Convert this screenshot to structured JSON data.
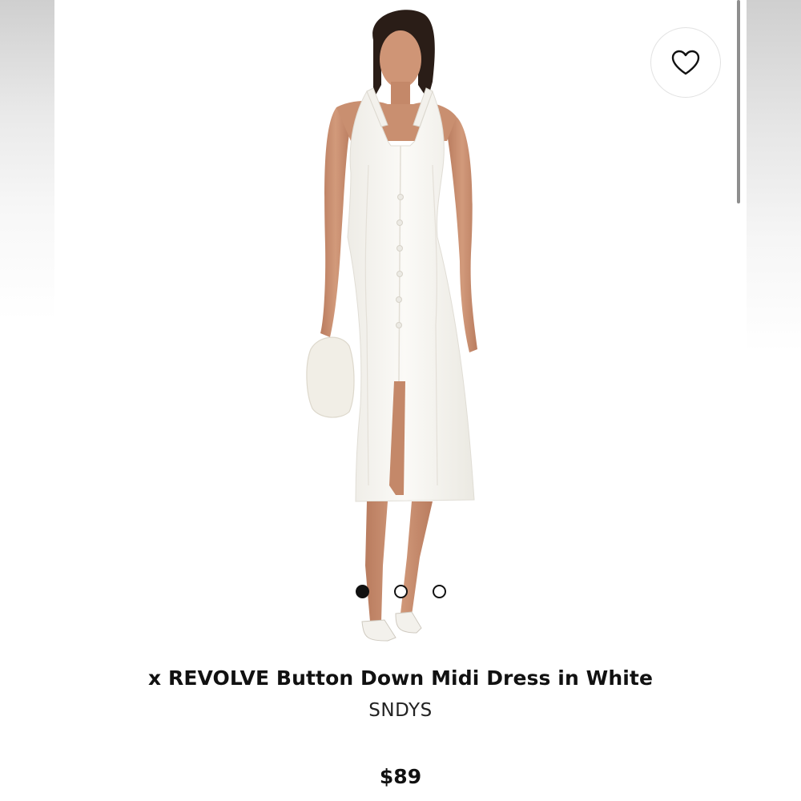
{
  "product": {
    "title": "x REVOLVE Button Down Midi Dress in White",
    "brand": "SNDYS",
    "price": "$89"
  },
  "carousel": {
    "total_images": 3,
    "active_index": 0
  },
  "icons": {
    "favorite": "heart-outline-icon"
  },
  "colors": {
    "text": "#111111",
    "dress": "#f8f7f3",
    "skin": "#c98f70"
  }
}
